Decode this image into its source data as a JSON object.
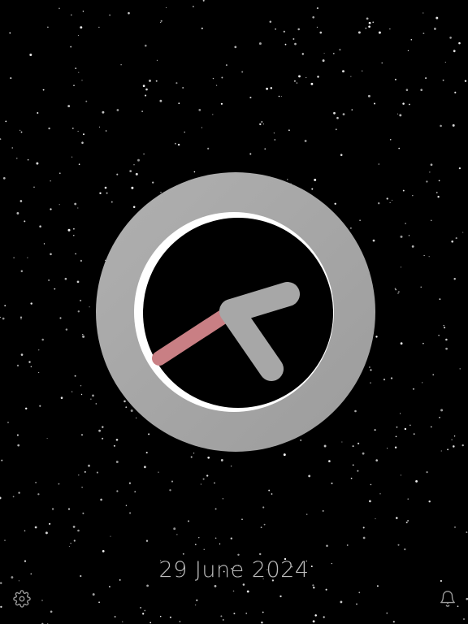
{
  "screen": {
    "background_color": "#000000",
    "star_color": "#ffffff"
  },
  "clock": {
    "ring_color": "#a8a8a8",
    "ring_highlight_color": "#ffffff",
    "hand_color": "#a7a7a7",
    "second_hand_color": "#c97f84",
    "time_shown": {
      "hour": 4,
      "minute": 12,
      "second": 41
    }
  },
  "date": {
    "label": "29 June 2024"
  },
  "toolbar": {
    "settings_icon": "gear-icon",
    "alarm_icon": "bell-icon",
    "icon_color": "#9a9a9a"
  }
}
